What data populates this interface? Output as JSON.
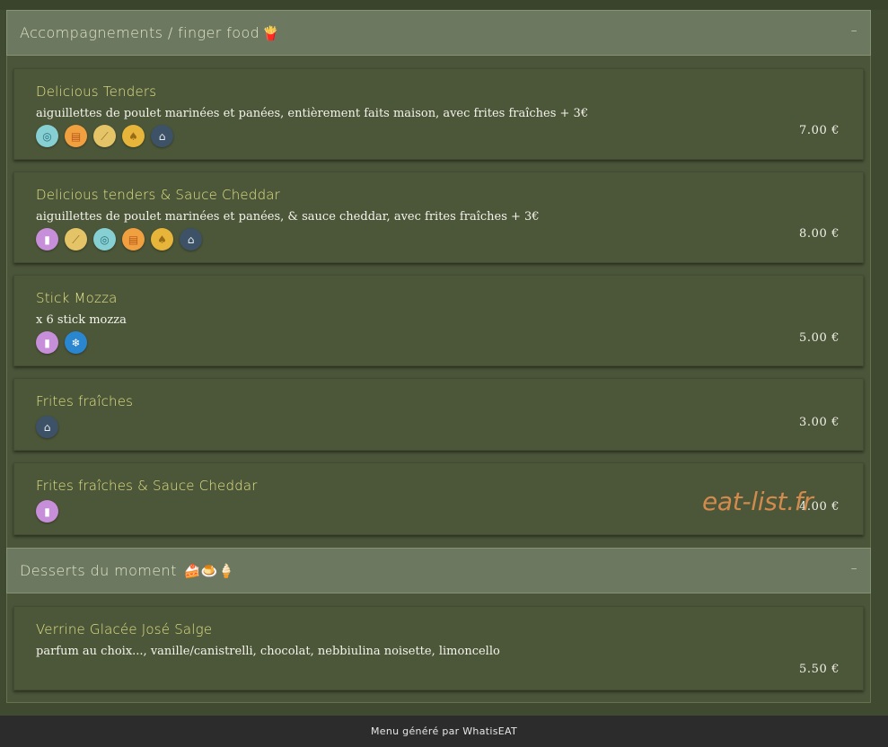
{
  "sections": [
    {
      "title": "Accompagnements / finger food",
      "emoji": "🍟",
      "toggle": "–",
      "items": [
        {
          "name": "Delicious Tenders",
          "description": "aiguillettes de poulet marinées et panées, entièrement faits maison, avec frites fraîches + 3€",
          "price": "7.00 €",
          "icons": [
            "fish-icon",
            "egg-icon",
            "gluten-icon",
            "mustard-icon",
            "homemade-icon"
          ]
        },
        {
          "name": "Delicious tenders & Sauce Cheddar",
          "description": "aiguillettes de poulet marinées et panées, & sauce cheddar, avec frites fraîches + 3€",
          "price": "8.00 €",
          "icons": [
            "milk-icon",
            "gluten-icon",
            "fish-icon",
            "egg-icon",
            "mustard-icon",
            "homemade-icon"
          ]
        },
        {
          "name": "Stick Mozza",
          "description": "x 6 stick mozza",
          "price": "5.00 €",
          "icons": [
            "milk-icon",
            "frozen-icon"
          ]
        },
        {
          "name": "Frites fraîches",
          "description": "",
          "price": "3.00 €",
          "icons": [
            "homemade-icon"
          ]
        },
        {
          "name": "Frites fraîches & Sauce Cheddar",
          "description": "",
          "price": "4.00 €",
          "icons": [
            "milk-icon"
          ]
        }
      ]
    },
    {
      "title": "Desserts du moment",
      "emoji": "🍰🍮🍦",
      "toggle": "–",
      "items": [
        {
          "name": "Verrine Glacée José Salge",
          "description": "parfum au choix..., vanille/canistrelli, chocolat, nebbiulina noisette, limoncello",
          "price": "5.50 €",
          "icons": []
        }
      ]
    }
  ],
  "watermark": "eat-list.fr",
  "footer": {
    "text": "Menu généré par WhatisEAT"
  },
  "colors": {
    "background": "#3f4a31",
    "card": "#4c5638",
    "section_header": "#6c7860",
    "item_name": "#e2e287",
    "watermark": "#d28a4d",
    "footer": "#2b2c2b"
  }
}
